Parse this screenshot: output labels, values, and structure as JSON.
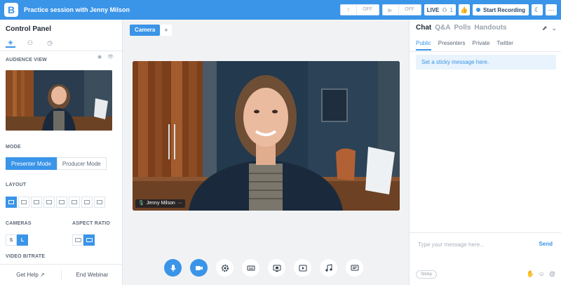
{
  "header": {
    "logo_letter": "B",
    "session_title": "Practice session with Jenny Milson",
    "facebook": {
      "icon": "facebook-icon",
      "glyph": "f",
      "state": "OFF"
    },
    "youtube": {
      "icon": "youtube-icon",
      "glyph": "▶",
      "state": "OFF"
    },
    "live_label": "LIVE",
    "attendee_count": "1",
    "start_recording_label": "Start Recording",
    "thumbs_glyph": "👍",
    "night_glyph": "☾",
    "more_glyph": "···"
  },
  "control_panel": {
    "title": "Control Panel",
    "tabs": [
      {
        "name": "layers-icon",
        "glyph": "◈"
      },
      {
        "name": "person-icon",
        "glyph": "⚇"
      },
      {
        "name": "clock-icon",
        "glyph": "◷"
      }
    ],
    "audience_view_label": "AUDIENCE VIEW",
    "audience_icons": [
      "◉",
      "👁"
    ],
    "mode_label": "MODE",
    "modes": [
      {
        "label": "Presenter Mode",
        "active": true
      },
      {
        "label": "Producer Mode",
        "active": false
      }
    ],
    "layout_label": "LAYOUT",
    "layout_count": 8,
    "cameras_label": "CAMERAS",
    "camera_sizes": [
      {
        "label": "S",
        "active": false
      },
      {
        "label": "L",
        "active": true
      }
    ],
    "aspect_ratio_label": "ASPECT RATIO",
    "video_bitrate_label": "VIDEO BITRATE",
    "get_help_label": "Get Help ↗",
    "end_webinar_label": "End Webinar"
  },
  "stage": {
    "camera_tab_label": "Camera",
    "add_tab_label": "+",
    "presenter_name": "Jenny Milson",
    "name_tag_more": "···",
    "name_tag_mic": "🎙"
  },
  "controls": [
    {
      "name": "microphone-button",
      "icon": "mic",
      "active": true
    },
    {
      "name": "camera-button",
      "icon": "cam",
      "active": true
    },
    {
      "name": "settings-button",
      "icon": "gear",
      "active": false
    },
    {
      "name": "keyboard-button",
      "icon": "kbd",
      "active": false
    },
    {
      "name": "screen-share-button",
      "icon": "screen",
      "active": false
    },
    {
      "name": "video-button",
      "icon": "film",
      "active": false
    },
    {
      "name": "music-button",
      "icon": "music",
      "active": false
    },
    {
      "name": "message-button",
      "icon": "msg",
      "active": false
    }
  ],
  "chat": {
    "tabs": [
      {
        "label": "Chat",
        "active": true
      },
      {
        "label": "Q&A",
        "active": false
      },
      {
        "label": "Polls",
        "active": false
      },
      {
        "label": "Handouts",
        "active": false
      }
    ],
    "header_icons": [
      "⬈",
      "⌄"
    ],
    "subtabs": [
      {
        "label": "Public",
        "active": true
      },
      {
        "label": "Presenters",
        "active": false
      },
      {
        "label": "Private",
        "active": false
      },
      {
        "label": "Twitter",
        "active": false
      }
    ],
    "sticky_placeholder": "Set a sticky message here.",
    "message_placeholder": "Type your message here...",
    "send_label": "Send",
    "sticky_chip_label": "Sticky",
    "bottom_icons": [
      "✋",
      "☺",
      "@"
    ]
  },
  "colors": {
    "brand": "#3a94e8",
    "panel": "#ffffff",
    "canvas": "#f1f2f4"
  }
}
